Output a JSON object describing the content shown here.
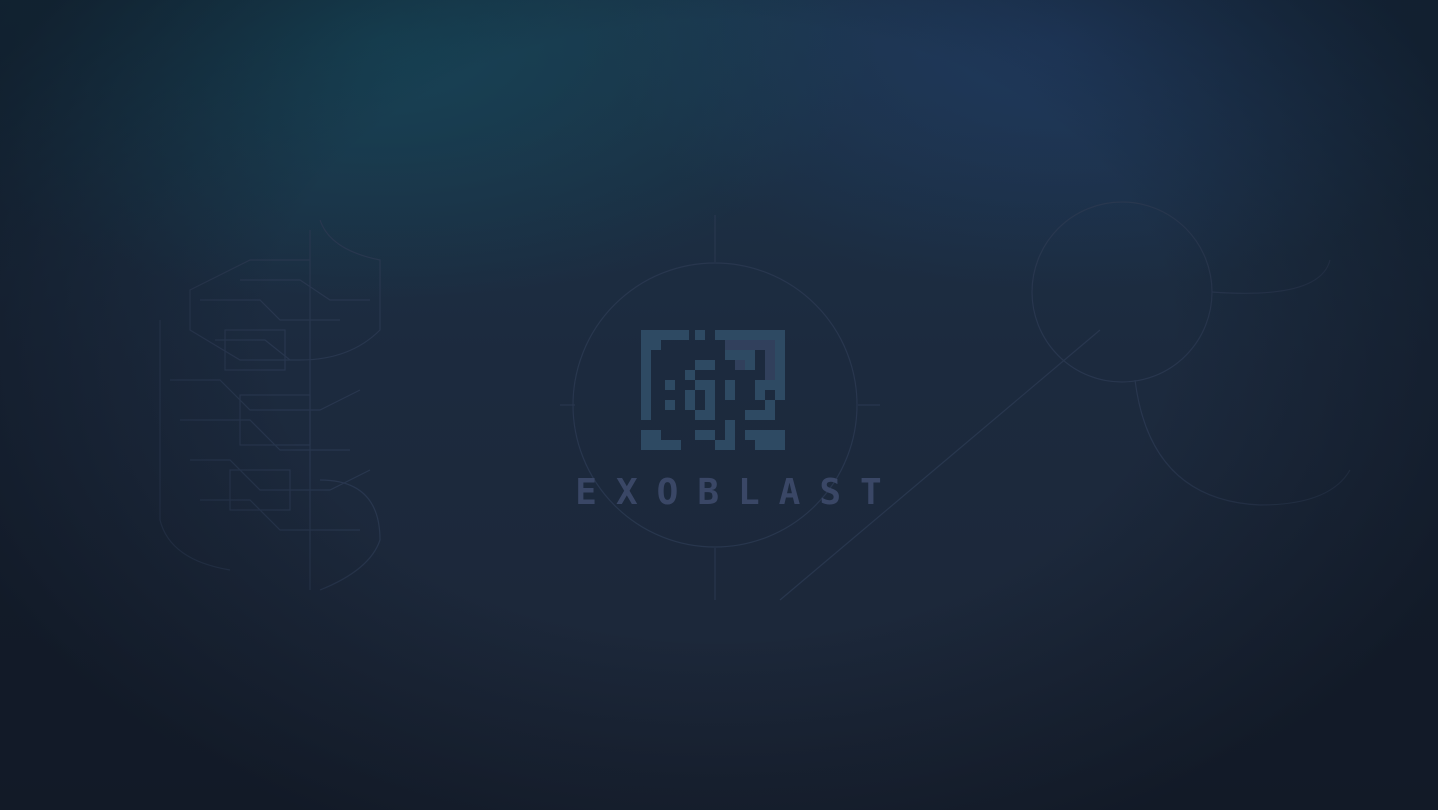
{
  "splash": {
    "game_title": "EXOBLAST",
    "logo_icon": "pixel-glyph-emblem-icon",
    "background_motif": "circuit-line-art"
  },
  "colors": {
    "background_top_teal": "#163f52",
    "background_top_blue": "#203a60",
    "background_bottom": "#1c2637",
    "line_art": "#2a3850",
    "logo_glyph": "#2e4a63",
    "logo_text": "#3a4766"
  }
}
